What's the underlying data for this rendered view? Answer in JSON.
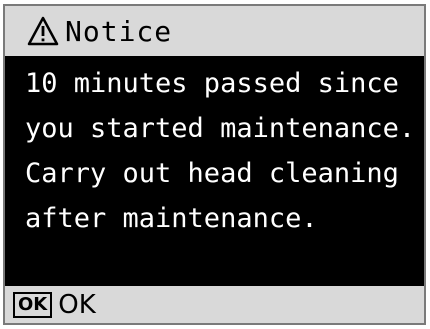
{
  "dialog": {
    "title": "Notice",
    "title_icon": "warning-triangle-icon",
    "message_lines": [
      "10 minutes passed since",
      "you started maintenance.",
      "Carry out head cleaning",
      "after maintenance."
    ]
  },
  "footer": {
    "key_label": "OK",
    "action_label": "OK"
  },
  "colors": {
    "screen_background": "#000000",
    "bar_background": "#d9d9d9",
    "message_text": "#ffffff"
  }
}
